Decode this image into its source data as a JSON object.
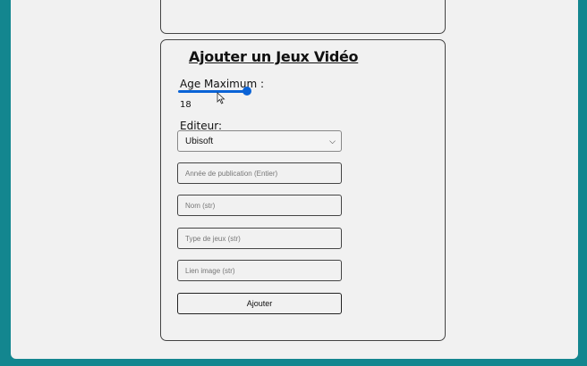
{
  "form": {
    "title": "Ajouter un Jeux Vidéo",
    "age_label": "Age Maximum :",
    "age_value": "18",
    "age_slider_fraction": 1.0,
    "editor_label": "Editeur:",
    "editor_selected": "Ubisoft",
    "fields": [
      {
        "placeholder": "Année de publication (Entier)"
      },
      {
        "placeholder": "Nom (str)"
      },
      {
        "placeholder": "Type de jeux (str)"
      },
      {
        "placeholder": "Lien image (str)"
      }
    ],
    "submit_label": "Ajouter"
  },
  "colors": {
    "background": "#13868f",
    "page": "#f1f1f1",
    "accent": "#0a63d6"
  },
  "icons": {
    "cursor": "mouse-pointer-icon",
    "select_chevron": "chevron-down-icon"
  }
}
